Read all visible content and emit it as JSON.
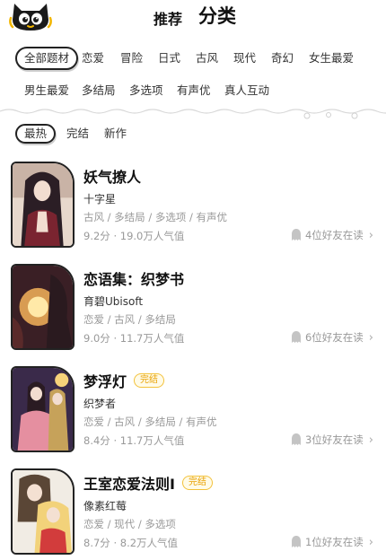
{
  "header": {
    "tab_recommend": "推荐",
    "tab_category": "分类"
  },
  "genres": [
    "全部题材",
    "恋爱",
    "冒险",
    "日式",
    "古风",
    "现代",
    "奇幻",
    "女生最爱",
    "男生最爱",
    "多结局",
    "多选项",
    "有声优",
    "真人互动"
  ],
  "genre_selected": "全部题材",
  "sort": [
    "最热",
    "完结",
    "新作"
  ],
  "sort_selected": "最热",
  "items": [
    {
      "title": "妖气撩人",
      "badge": "",
      "author": "十字星",
      "tags": "古风 / 多结局 / 多选项 / 有声优",
      "stats": "9.2分 · 19.0万人气值",
      "friends": "4位好友在读"
    },
    {
      "title": "恋语集：织梦书",
      "badge": "",
      "author": "育碧Ubisoft",
      "tags": "恋爱 / 古风 / 多结局",
      "stats": "9.0分 · 11.7万人气值",
      "friends": "6位好友在读"
    },
    {
      "title": "梦浮灯",
      "badge": "完结",
      "author": "织梦者",
      "tags": "恋爱 / 古风 / 多结局 / 有声优",
      "stats": "8.4分 · 11.7万人气值",
      "friends": "3位好友在读"
    },
    {
      "title": "王室恋爱法则Ⅰ",
      "badge": "完结",
      "author": "像素红莓",
      "tags": "恋爱 / 现代 / 多选项",
      "stats": "8.7分 · 8.2万人气值",
      "friends": "1位好友在读"
    }
  ],
  "colors": {
    "accent_yellow": "#ffd21f",
    "badge_orange": "#e8a000",
    "muted_gray": "#999999"
  }
}
